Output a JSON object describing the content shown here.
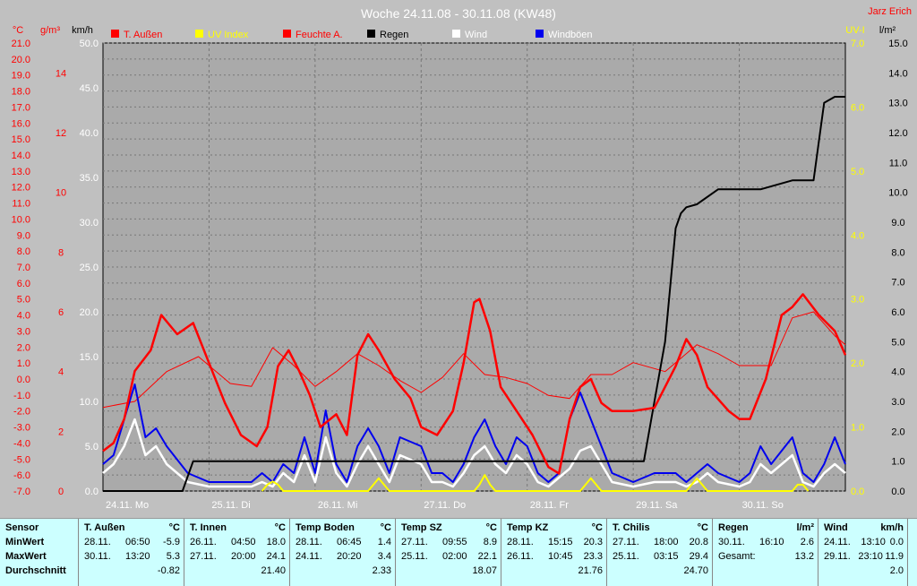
{
  "title": "Woche 24.11.08 - 30.11.08 (KW48)",
  "author": "Jarz Erich",
  "colors": {
    "plot_bg": "#aaaaaa",
    "t_aussen": "#ff0000",
    "feuchte": "#ff0000",
    "uv": "#ffff00",
    "regen": "#000000",
    "wind": "#ffffff",
    "windboeen": "#0000ee",
    "left_axis": "#ff0000",
    "uv_axis": "#ffff00"
  },
  "chart_data": {
    "type": "line",
    "title": "Woche 24.11.08 - 30.11.08 (KW48)",
    "legend_position": "top",
    "grid": true,
    "x_ticks": [
      "24.11. Mo",
      "25.11. Di",
      "26.11. Mi",
      "27.11. Do",
      "28.11. Fr",
      "29.11. Sa",
      "30.11. So"
    ],
    "x_range": [
      0,
      7
    ],
    "axes": {
      "temp": {
        "unit": "°C",
        "ylim": [
          -7.0,
          21.0
        ],
        "ticks": [
          "21.0",
          "20.0",
          "19.0",
          "18.0",
          "17.0",
          "16.0",
          "15.0",
          "14.0",
          "13.0",
          "12.0",
          "11.0",
          "10.0",
          "9.0",
          "8.0",
          "7.0",
          "6.0",
          "5.0",
          "4.0",
          "3.0",
          "2.0",
          "1.0",
          "0.0",
          "-1.0",
          "-2.0",
          "-3.0",
          "-4.0",
          "-5.0",
          "-6.0",
          "-7.0"
        ]
      },
      "humidity": {
        "unit": "g/m³",
        "ylim": [
          0,
          15
        ],
        "ticks": [
          "14",
          "12",
          "10",
          "8",
          "6",
          "4",
          "2",
          "0"
        ]
      },
      "wind": {
        "unit": "km/h",
        "ylim": [
          0,
          50
        ],
        "ticks": [
          "50.0",
          "45.0",
          "40.0",
          "35.0",
          "30.0",
          "25.0",
          "20.0",
          "15.0",
          "10.0",
          "5.0",
          "0.0"
        ]
      },
      "uv": {
        "unit": "UV-I",
        "ylim": [
          0,
          7
        ],
        "ticks": [
          "7.0",
          "6.0",
          "5.0",
          "4.0",
          "3.0",
          "2.0",
          "1.0",
          "0.0"
        ]
      },
      "rain": {
        "unit": "l/m²",
        "ylim": [
          0,
          15
        ],
        "ticks": [
          "15.0",
          "14.0",
          "13.0",
          "12.0",
          "11.0",
          "10.0",
          "9.0",
          "8.0",
          "7.0",
          "6.0",
          "5.0",
          "4.0",
          "3.0",
          "2.0",
          "1.0",
          "0.0"
        ]
      }
    },
    "series": [
      {
        "name": "T. Außen",
        "axis": "temp",
        "x": [
          0,
          0.1,
          0.2,
          0.3,
          0.45,
          0.55,
          0.7,
          0.85,
          1.0,
          1.15,
          1.3,
          1.45,
          1.55,
          1.65,
          1.75,
          1.85,
          1.95,
          2.05,
          2.2,
          2.3,
          2.4,
          2.5,
          2.6,
          2.75,
          2.9,
          3.0,
          3.15,
          3.3,
          3.4,
          3.5,
          3.55,
          3.65,
          3.75,
          3.9,
          4.05,
          4.2,
          4.3,
          4.4,
          4.5,
          4.6,
          4.7,
          4.8,
          5.0,
          5.2,
          5.4,
          5.5,
          5.6,
          5.7,
          5.9,
          6.0,
          6.1,
          6.25,
          6.4,
          6.5,
          6.6,
          6.75,
          6.9,
          7.0
        ],
        "values": [
          -4.5,
          -4.0,
          -2.5,
          0.5,
          1.8,
          4.0,
          2.8,
          3.5,
          1.0,
          -1.5,
          -3.5,
          -4.2,
          -3.0,
          0.8,
          1.8,
          0.5,
          -1.0,
          -3.0,
          -2.2,
          -3.5,
          1.5,
          2.8,
          1.8,
          0.0,
          -1.2,
          -3.0,
          -3.5,
          -2.0,
          1.0,
          4.8,
          5.0,
          3.0,
          -0.5,
          -2.0,
          -3.5,
          -5.5,
          -5.9,
          -2.5,
          -0.5,
          0.0,
          -1.5,
          -2.0,
          -2.0,
          -1.8,
          0.8,
          2.5,
          1.5,
          -0.5,
          -2.0,
          -2.5,
          -2.5,
          0.0,
          4.0,
          4.5,
          5.3,
          4.0,
          3.0,
          1.5
        ]
      },
      {
        "name": "Feuchte A.",
        "axis": "humidity",
        "x": [
          0,
          0.3,
          0.6,
          0.9,
          1.2,
          1.4,
          1.6,
          1.8,
          2.0,
          2.2,
          2.4,
          2.6,
          2.8,
          3.0,
          3.2,
          3.4,
          3.6,
          3.8,
          4.0,
          4.2,
          4.4,
          4.6,
          4.8,
          5.0,
          5.3,
          5.6,
          5.8,
          6.0,
          6.3,
          6.5,
          6.7,
          6.9,
          7.0
        ],
        "values": [
          2.8,
          3.0,
          4.0,
          4.5,
          3.6,
          3.5,
          4.8,
          4.2,
          3.5,
          4.0,
          4.6,
          4.2,
          3.7,
          3.3,
          3.8,
          4.6,
          3.9,
          3.8,
          3.6,
          3.2,
          3.1,
          3.9,
          3.9,
          4.3,
          4.0,
          4.9,
          4.6,
          4.2,
          4.2,
          5.8,
          6.0,
          5.2,
          4.9
        ]
      },
      {
        "name": "UV Index",
        "axis": "uv",
        "x": [
          1.5,
          1.55,
          1.6,
          1.65,
          1.7,
          2.5,
          2.55,
          2.6,
          2.65,
          2.7,
          3.5,
          3.55,
          3.6,
          3.65,
          3.7,
          4.5,
          4.55,
          4.6,
          4.65,
          4.7,
          5.5,
          5.55,
          5.6,
          5.65,
          5.7,
          6.5,
          6.55,
          6.6,
          6.65
        ],
        "values": [
          0,
          0.1,
          0.15,
          0.1,
          0,
          0,
          0.1,
          0.2,
          0.1,
          0,
          0,
          0.1,
          0.25,
          0.1,
          0,
          0,
          0.1,
          0.2,
          0.1,
          0,
          0,
          0.1,
          0.2,
          0.1,
          0,
          0,
          0.1,
          0.1,
          0
        ]
      },
      {
        "name": "Regen",
        "axis": "rain",
        "x": [
          0,
          0.75,
          0.85,
          5.1,
          5.2,
          5.3,
          5.4,
          5.45,
          5.5,
          5.6,
          5.8,
          6.0,
          6.2,
          6.5,
          6.7,
          6.8,
          6.9,
          7.0
        ],
        "values": [
          0,
          0,
          1.0,
          1.0,
          3.0,
          5.0,
          8.8,
          9.3,
          9.5,
          9.6,
          10.1,
          10.1,
          10.1,
          10.4,
          10.4,
          13.0,
          13.2,
          13.2
        ]
      },
      {
        "name": "Wind",
        "axis": "wind",
        "x": [
          0,
          0.1,
          0.2,
          0.3,
          0.4,
          0.5,
          0.6,
          0.8,
          1.0,
          1.4,
          1.5,
          1.6,
          1.7,
          1.8,
          1.9,
          2.0,
          2.1,
          2.2,
          2.3,
          2.4,
          2.5,
          2.6,
          2.7,
          2.8,
          3.0,
          3.1,
          3.2,
          3.3,
          3.4,
          3.5,
          3.6,
          3.7,
          3.8,
          3.9,
          4.0,
          4.1,
          4.2,
          4.3,
          4.4,
          4.5,
          4.6,
          4.7,
          4.8,
          5.0,
          5.2,
          5.4,
          5.5,
          5.6,
          5.7,
          5.8,
          6.0,
          6.1,
          6.2,
          6.3,
          6.5,
          6.6,
          6.7,
          6.8,
          6.9,
          7.0
        ],
        "values": [
          2,
          3,
          5,
          8,
          4,
          5,
          3,
          1,
          0.5,
          0.5,
          1,
          0.5,
          2,
          1,
          4,
          1,
          6,
          2,
          0.5,
          3,
          5,
          3,
          1,
          4,
          3,
          1,
          1,
          0.5,
          2,
          4,
          5,
          3,
          2,
          4,
          3,
          1,
          0.5,
          1.5,
          2.5,
          4.5,
          5,
          3,
          1,
          0.5,
          1,
          1,
          0.5,
          1,
          2,
          1,
          0.5,
          1,
          3,
          2,
          4,
          1,
          0.5,
          2,
          3,
          2
        ]
      },
      {
        "name": "Windböen",
        "axis": "wind",
        "x": [
          0,
          0.1,
          0.2,
          0.3,
          0.4,
          0.5,
          0.6,
          0.8,
          1.0,
          1.4,
          1.5,
          1.6,
          1.7,
          1.8,
          1.9,
          2.0,
          2.1,
          2.2,
          2.3,
          2.4,
          2.5,
          2.6,
          2.7,
          2.8,
          3.0,
          3.1,
          3.2,
          3.3,
          3.4,
          3.5,
          3.6,
          3.7,
          3.8,
          3.9,
          4.0,
          4.1,
          4.2,
          4.3,
          4.4,
          4.5,
          4.6,
          4.7,
          4.8,
          5.0,
          5.2,
          5.4,
          5.5,
          5.6,
          5.7,
          5.8,
          6.0,
          6.1,
          6.2,
          6.3,
          6.5,
          6.6,
          6.7,
          6.8,
          6.9,
          7.0
        ],
        "values": [
          3,
          4,
          8,
          11.9,
          6,
          7,
          5,
          2,
          1,
          1,
          2,
          1,
          3,
          2,
          6,
          2,
          9,
          3,
          1,
          5,
          7,
          5,
          2,
          6,
          5,
          2,
          2,
          1,
          3,
          6,
          8,
          5,
          3,
          6,
          5,
          2,
          1,
          2,
          8,
          11,
          8,
          5,
          2,
          1,
          2,
          2,
          1,
          2,
          3,
          2,
          1,
          2,
          5,
          3,
          6,
          2,
          1,
          3,
          6,
          3
        ]
      }
    ],
    "legend": [
      "T. Außen",
      "UV Index",
      "Feuchte A.",
      "Regen",
      "Wind",
      "Windböen"
    ]
  },
  "table": {
    "row_labels": [
      "Sensor",
      "MinWert",
      "MaxWert",
      "Durchschnitt"
    ],
    "columns": [
      {
        "name": "T. Außen",
        "unit": "°C",
        "min": [
          "28.11.",
          "06:50",
          "-5.9"
        ],
        "max": [
          "30.11.",
          "13:20",
          "5.3"
        ],
        "avg": "-0.82"
      },
      {
        "name": "T. Innen",
        "unit": "°C",
        "min": [
          "26.11.",
          "04:50",
          "18.0"
        ],
        "max": [
          "27.11.",
          "20:00",
          "24.1"
        ],
        "avg": "21.40"
      },
      {
        "name": "Temp Boden",
        "unit": "°C",
        "min": [
          "28.11.",
          "06:45",
          "1.4"
        ],
        "max": [
          "24.11.",
          "20:20",
          "3.4"
        ],
        "avg": "2.33"
      },
      {
        "name": "Temp SZ",
        "unit": "°C",
        "min": [
          "27.11.",
          "09:55",
          "8.9"
        ],
        "max": [
          "25.11.",
          "02:00",
          "22.1"
        ],
        "avg": "18.07"
      },
      {
        "name": "Temp KZ",
        "unit": "°C",
        "min": [
          "28.11.",
          "15:15",
          "20.3"
        ],
        "max": [
          "26.11.",
          "10:45",
          "23.3"
        ],
        "avg": "21.76"
      },
      {
        "name": "T. Chilis",
        "unit": "°C",
        "min": [
          "27.11.",
          "18:00",
          "20.8"
        ],
        "max": [
          "25.11.",
          "03:15",
          "29.4"
        ],
        "avg": "24.70"
      },
      {
        "name": "Regen",
        "unit": "l/m²",
        "min": [
          "30.11.",
          "16:10",
          "2.6"
        ],
        "max": [
          "Gesamt:",
          "",
          "13.2"
        ],
        "avg": ""
      },
      {
        "name": "Wind",
        "unit": "km/h",
        "min": [
          "24.11.",
          "13:10",
          "0.0"
        ],
        "max": [
          "29.11.",
          "23:10",
          "11.9"
        ],
        "avg": "2.0"
      }
    ]
  }
}
